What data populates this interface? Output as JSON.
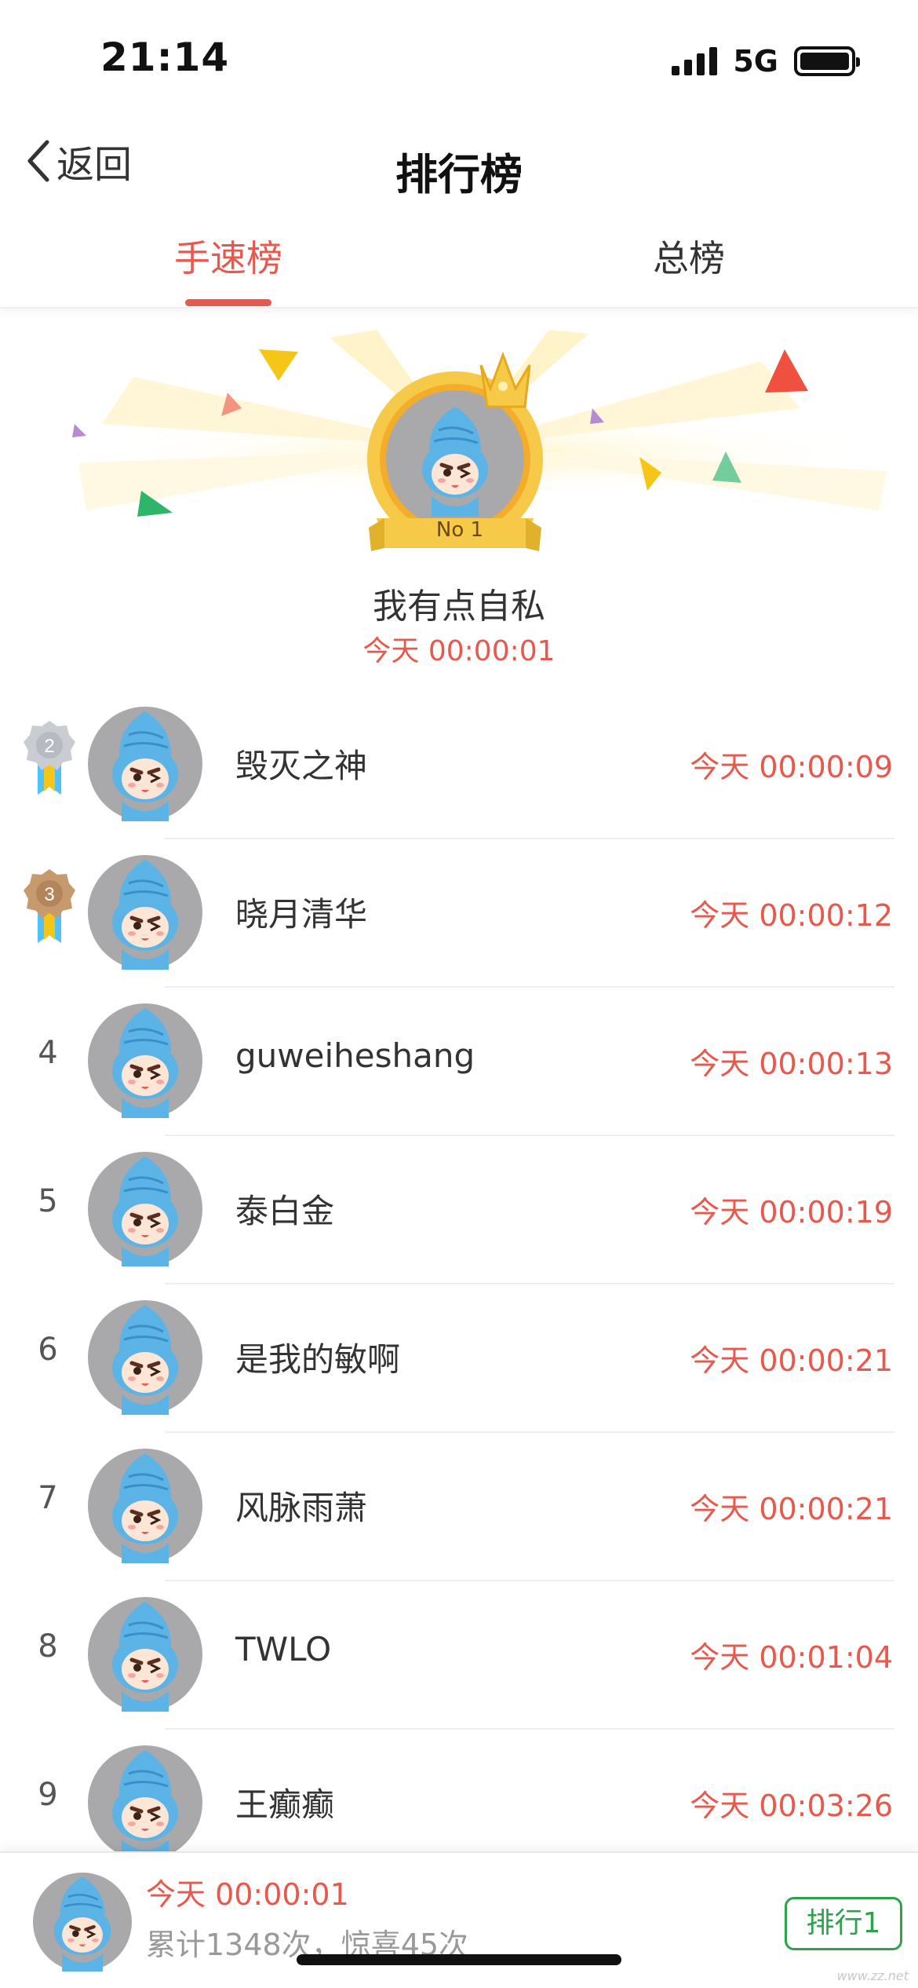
{
  "status_bar": {
    "time": "21:14",
    "network": "5G"
  },
  "nav": {
    "back_label": "返回",
    "title": "排行榜"
  },
  "tabs": [
    {
      "label": "手速榜",
      "active": true
    },
    {
      "label": "总榜",
      "active": false
    }
  ],
  "podium": {
    "badge": "No 1",
    "name": "我有点自私",
    "time": "今天 00:00:01"
  },
  "rankings": [
    {
      "rank": "2",
      "name": "毁灭之神",
      "time": "今天 00:00:09"
    },
    {
      "rank": "3",
      "name": "晓月清华",
      "time": "今天 00:00:12"
    },
    {
      "rank": "4",
      "name": "guweiheshang",
      "time": "今天 00:00:13"
    },
    {
      "rank": "5",
      "name": "泰白金",
      "time": "今天 00:00:19"
    },
    {
      "rank": "6",
      "name": "是我的敏啊",
      "time": "今天 00:00:21"
    },
    {
      "rank": "7",
      "name": "风脉雨萧",
      "time": "今天 00:00:21"
    },
    {
      "rank": "8",
      "name": "TWLO",
      "time": "今天 00:01:04"
    },
    {
      "rank": "9",
      "name": "王癫癫",
      "time": "今天 00:03:26"
    }
  ],
  "my_record": {
    "time": "今天 00:00:01",
    "stats": "累计1348次，惊喜45次",
    "rank_button": "排行1"
  },
  "colors": {
    "accent": "#e8584c",
    "green": "#2ea24a",
    "gold": "#f7c948",
    "silver": "#c9ccd2",
    "bronze": "#c79a6e"
  },
  "watermark": "www.zz.net"
}
